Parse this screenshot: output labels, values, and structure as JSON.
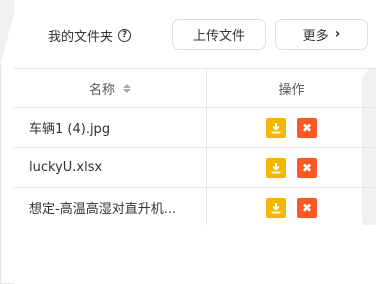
{
  "header": {
    "title": "我的文件夹",
    "help_glyph": "?",
    "upload_label": "上传文件",
    "more_label": "更多",
    "more_chevron": "›"
  },
  "table": {
    "columns": [
      "名称",
      "操作"
    ],
    "rows": [
      {
        "name": "车辆1 (4).jpg"
      },
      {
        "name": "luckyU.xlsx"
      },
      {
        "name": "想定-高温高湿对直升机..."
      }
    ]
  },
  "icons": {
    "download": "download-icon",
    "delete": "close-icon"
  },
  "colors": {
    "download_bg": "#f5b800",
    "delete_bg": "#ff5722"
  }
}
